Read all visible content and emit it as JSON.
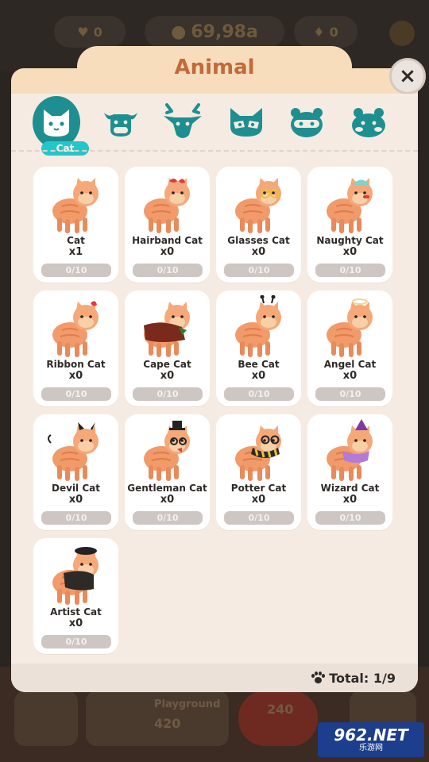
{
  "background": {
    "hearts": "0",
    "coins": "69,98a",
    "gems": "0",
    "playground_label": "Playground",
    "playground_value": "420",
    "center_value": "240"
  },
  "modal": {
    "title": "Animal",
    "close_label": "×",
    "tabs": [
      {
        "icon": "cat-face-icon",
        "label": "Cat",
        "active": true
      },
      {
        "icon": "cow-face-icon",
        "label": "",
        "active": false
      },
      {
        "icon": "deer-face-icon",
        "label": "",
        "active": false
      },
      {
        "icon": "raccoon-face-icon",
        "label": "",
        "active": false
      },
      {
        "icon": "tanuki-face-icon",
        "label": "",
        "active": false
      },
      {
        "icon": "hamster-face-icon",
        "label": "",
        "active": false
      }
    ],
    "cards": [
      {
        "name": "Cat",
        "count": "x1",
        "progress": "0/10",
        "fill": 0,
        "accessory": "none"
      },
      {
        "name": "Hairband Cat",
        "count": "x0",
        "progress": "0/10",
        "fill": 0,
        "accessory": "hairband"
      },
      {
        "name": "Glasses Cat",
        "count": "x0",
        "progress": "0/10",
        "fill": 0,
        "accessory": "glasses"
      },
      {
        "name": "Naughty Cat",
        "count": "x0",
        "progress": "0/10",
        "fill": 0,
        "accessory": "cap"
      },
      {
        "name": "Ribbon Cat",
        "count": "x0",
        "progress": "0/10",
        "fill": 0,
        "accessory": "ribbon"
      },
      {
        "name": "Cape Cat",
        "count": "x0",
        "progress": "0/10",
        "fill": 0,
        "accessory": "cape"
      },
      {
        "name": "Bee Cat",
        "count": "x0",
        "progress": "0/10",
        "fill": 0,
        "accessory": "bee"
      },
      {
        "name": "Angel Cat",
        "count": "x0",
        "progress": "0/10",
        "fill": 0,
        "accessory": "halo"
      },
      {
        "name": "Devil Cat",
        "count": "x0",
        "progress": "0/10",
        "fill": 0,
        "accessory": "devil"
      },
      {
        "name": "Gentleman Cat",
        "count": "x0",
        "progress": "0/10",
        "fill": 0,
        "accessory": "tophat"
      },
      {
        "name": "Potter Cat",
        "count": "x0",
        "progress": "0/10",
        "fill": 0,
        "accessory": "scarf"
      },
      {
        "name": "Wizard Cat",
        "count": "x0",
        "progress": "0/10",
        "fill": 0,
        "accessory": "wizard"
      },
      {
        "name": "Artist Cat",
        "count": "x0",
        "progress": "0/10",
        "fill": 0,
        "accessory": "beret"
      }
    ],
    "total": "Total: 1/9"
  },
  "watermark": {
    "big": "962.NET",
    "small": "乐游网"
  },
  "colors": {
    "accent": "#1e8f90",
    "title": "#c16a3c",
    "cat_body": "#f19a6a"
  }
}
